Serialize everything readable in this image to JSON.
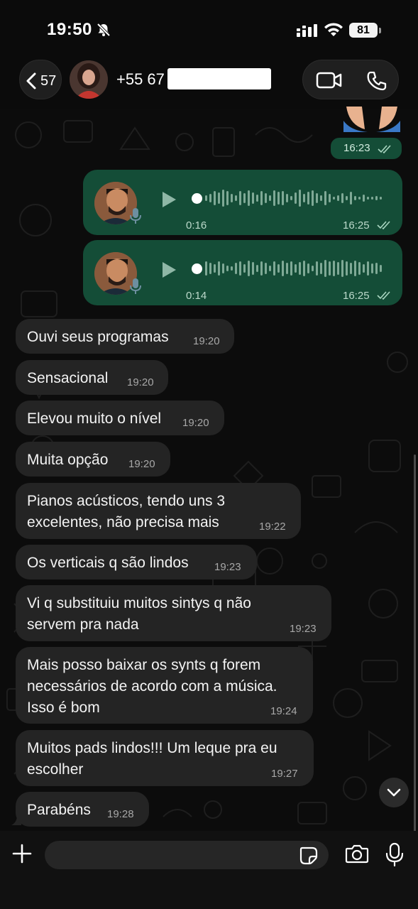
{
  "status_bar": {
    "time": "19:50",
    "battery": "81",
    "icons": [
      "bell-slash-icon",
      "cellular-signal-icon",
      "wifi-icon",
      "battery-icon"
    ]
  },
  "header": {
    "back_count": "57",
    "contact_name": "+55 67",
    "icons": [
      "chevron-left-icon",
      "video-call-icon",
      "phone-call-icon"
    ]
  },
  "messages": {
    "top_time": "16:23",
    "voice_notes": [
      {
        "duration": "0:16",
        "time": "16:25"
      },
      {
        "duration": "0:14",
        "time": "16:25"
      }
    ],
    "incoming": [
      {
        "text": "Ouvi seus programas",
        "time": "19:20"
      },
      {
        "text": "Sensacional",
        "time": "19:20"
      },
      {
        "text": "Elevou muito o nível",
        "time": "19:20"
      },
      {
        "text": "Muita opção",
        "time": "19:20"
      },
      {
        "text": "Pianos acústicos, tendo uns 3\nexcelentes, não precisa mais",
        "time": "19:22"
      },
      {
        "text": "Os verticais q são lindos",
        "time": "19:23"
      },
      {
        "text": "Vi q substituiu muitos sintys q não\nservem pra nada",
        "time": "19:23"
      },
      {
        "text": "Mais posso baixar os synts q forem\nnecessários de acordo com a música.\nIsso é bom",
        "time": "19:24"
      },
      {
        "text": "Muitos pads lindos!!! Um leque pra eu\nescolher",
        "time": "19:27"
      },
      {
        "text": "Parabéns",
        "time": "19:28"
      }
    ]
  },
  "composer": {
    "placeholder": "",
    "icons": [
      "plus-icon",
      "sticker-icon",
      "camera-icon",
      "microphone-icon"
    ]
  },
  "colors": {
    "outgoing_bubble": "#144d37",
    "incoming_bubble": "#242424",
    "background": "#0c0c0c"
  }
}
